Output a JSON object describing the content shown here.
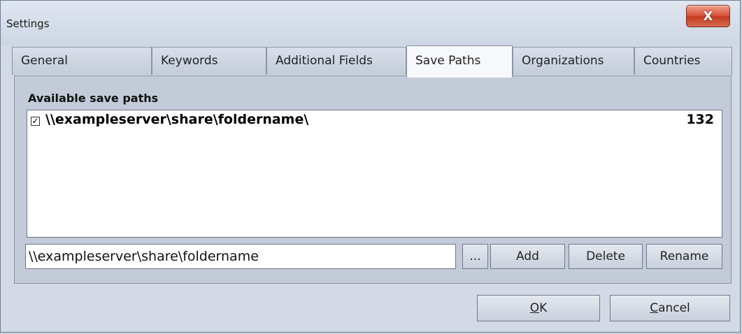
{
  "window": {
    "title": "Settings",
    "close_glyph": "X"
  },
  "tabs": [
    {
      "label": "General"
    },
    {
      "label": "Keywords"
    },
    {
      "label": "Additional Fields"
    },
    {
      "label": "Save Paths",
      "active": true
    },
    {
      "label": "Organizations"
    },
    {
      "label": "Countries"
    }
  ],
  "save_paths": {
    "section_label": "Available save paths",
    "items": [
      {
        "checked": true,
        "check_glyph": "✓",
        "path": "\\\\exampleserver\\share\\foldername\\",
        "count": "132"
      }
    ],
    "input_value": "\\\\exampleserver\\share\\foldername",
    "browse_label": "...",
    "add_label": "Add",
    "delete_label": "Delete",
    "rename_label": "Rename"
  },
  "footer": {
    "ok_mnemonic": "O",
    "ok_rest": "K",
    "cancel_mnemonic": "C",
    "cancel_rest": "ancel"
  },
  "icons": {
    "close": "close-icon",
    "checkbox": "checkmark-icon"
  },
  "colors": {
    "close_button": "#d9533a",
    "background": "#c4cbd8",
    "active_tab": "#f6f8fb"
  }
}
